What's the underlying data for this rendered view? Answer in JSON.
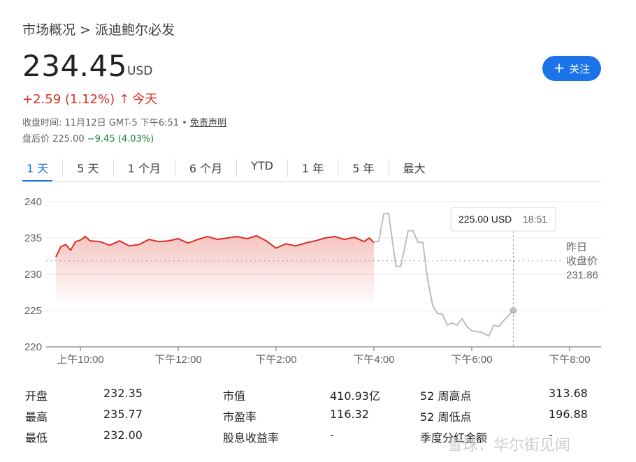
{
  "breadcrumb": "市场概况 > 派迪鲍尔必发",
  "price": "234.45",
  "currency": "USD",
  "follow_button": {
    "icon": "plus-icon",
    "label": "关注"
  },
  "change": {
    "text": "+2.59 (1.12%)",
    "arrow": "↑",
    "period": "今天",
    "color": "#d93025"
  },
  "close_info": {
    "text": "收盘时间: 11月12日 GMT-5 下午6:51 • ",
    "link": "免责声明"
  },
  "after_hours": {
    "label": "盘后价 225.00 ",
    "change": "−9.45 (4.03%)"
  },
  "tabs": [
    "1 天",
    "5 天",
    "1 个月",
    "6 个月",
    "YTD",
    "1 年",
    "5 年",
    "最大"
  ],
  "active_tab": "1 天",
  "tooltip": {
    "price": "225.00 USD",
    "time": "18:51"
  },
  "prev_close": {
    "line1": "昨日",
    "line2": "收盘价",
    "value": "231.86"
  },
  "colors": {
    "up": "#d93025",
    "accent": "#1a73e8",
    "after_line": "#bdbdbd",
    "down": "#188038"
  },
  "chart_data": {
    "type": "line",
    "y_ticks": [
      "240",
      "235",
      "230",
      "225",
      "220"
    ],
    "x_ticks": [
      "上午10:00",
      "下午12:00",
      "下午2:00",
      "下午4:00",
      "下午6:00",
      "下午8:00"
    ],
    "ylim": [
      220,
      241
    ],
    "xlim": [
      9.5,
      20.0
    ],
    "prev_close": 231.86,
    "series": [
      {
        "session": "regular",
        "x": [
          9.5,
          9.6,
          9.7,
          9.8,
          9.9,
          10.0,
          10.1,
          10.2,
          10.4,
          10.6,
          10.8,
          11.0,
          11.2,
          11.4,
          11.6,
          11.8,
          12.0,
          12.2,
          12.4,
          12.6,
          12.8,
          13.0,
          13.2,
          13.4,
          13.6,
          13.8,
          14.0,
          14.2,
          14.4,
          14.6,
          14.8,
          15.0,
          15.2,
          15.4,
          15.6,
          15.8,
          15.9,
          16.0
        ],
        "y": [
          232.4,
          233.8,
          234.1,
          233.3,
          234.5,
          234.7,
          235.2,
          234.6,
          234.5,
          234.0,
          234.6,
          233.9,
          234.1,
          234.8,
          234.5,
          234.6,
          234.9,
          234.3,
          234.8,
          235.2,
          234.8,
          235.0,
          235.2,
          234.9,
          235.3,
          234.6,
          233.6,
          234.2,
          233.9,
          234.3,
          234.6,
          235.0,
          235.2,
          234.8,
          235.1,
          234.5,
          235.0,
          234.4
        ]
      },
      {
        "session": "after-hours",
        "x": [
          16.0,
          16.1,
          16.2,
          16.3,
          16.45,
          16.55,
          16.7,
          16.8,
          16.9,
          17.0,
          17.1,
          17.2,
          17.3,
          17.4,
          17.5,
          17.6,
          17.7,
          17.8,
          17.9,
          18.0,
          18.2,
          18.35,
          18.45,
          18.55,
          18.65,
          18.85
        ],
        "y": [
          234.4,
          234.6,
          238.3,
          238.4,
          231.1,
          231.1,
          236.0,
          236.0,
          234.4,
          234.4,
          229.2,
          225.7,
          224.6,
          224.5,
          223.0,
          223.3,
          223.0,
          223.9,
          222.8,
          222.2,
          222.0,
          221.5,
          223.0,
          222.8,
          223.6,
          225.0
        ]
      }
    ]
  },
  "stats": [
    {
      "label": "开盘",
      "value": "232.35"
    },
    {
      "label": "最高",
      "value": "235.77"
    },
    {
      "label": "最低",
      "value": "232.00"
    },
    {
      "label": "市值",
      "value": "410.93亿"
    },
    {
      "label": "市盈率",
      "value": "116.32"
    },
    {
      "label": "股息收益率",
      "value": "-"
    },
    {
      "label": "52 周高点",
      "value": "313.68"
    },
    {
      "label": "52 周低点",
      "value": "196.88"
    },
    {
      "label": "季度分红金额",
      "value": "-"
    }
  ],
  "watermark": "雪球：华尔街见闻"
}
